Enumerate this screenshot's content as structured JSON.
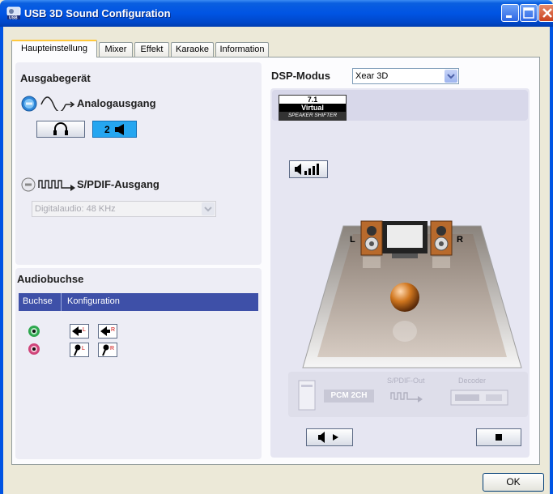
{
  "window": {
    "title": "USB 3D Sound Configuration",
    "icon": "usb-speaker-icon",
    "title_color": "#0054E3"
  },
  "tabs": [
    {
      "label": "Haupteinstellung",
      "active": true
    },
    {
      "label": "Mixer",
      "active": false
    },
    {
      "label": "Effekt",
      "active": false
    },
    {
      "label": "Karaoke",
      "active": false
    },
    {
      "label": "Information",
      "active": false
    }
  ],
  "output_device": {
    "heading": "Ausgabegerät",
    "analog_label": "Analogausgang",
    "analog_selected": true,
    "headphone_icon": "headphone-icon",
    "speaker_mode_label": "2",
    "spdif_label": "S/PDIF-Ausgang",
    "spdif_selected": false,
    "spdif_rate": "Digitalaudio: 48 KHz"
  },
  "audio_jack": {
    "heading": "Audiobuchse",
    "columns": [
      "Buchse",
      "Konfiguration"
    ],
    "rows": [
      {
        "jack_color": "#2FA84F",
        "config_icons": [
          "speaker-left-icon",
          "speaker-right-icon"
        ]
      },
      {
        "jack_color": "#D0457A",
        "config_icons": [
          "mic-left-icon",
          "mic-right-icon"
        ]
      }
    ]
  },
  "dsp": {
    "heading": "DSP-Modus",
    "mode": "Xear 3D",
    "badge_top": "7.1",
    "badge_mid": "Virtual",
    "badge_bottom": "SPEAKER SHIFTER",
    "speaker_left": "L",
    "speaker_right": "R",
    "spdif_out_label": "S/PDIF-Out",
    "decoder_label": "Decoder",
    "pcm_label": "PCM 2CH"
  },
  "buttons": {
    "ok": "OK"
  }
}
